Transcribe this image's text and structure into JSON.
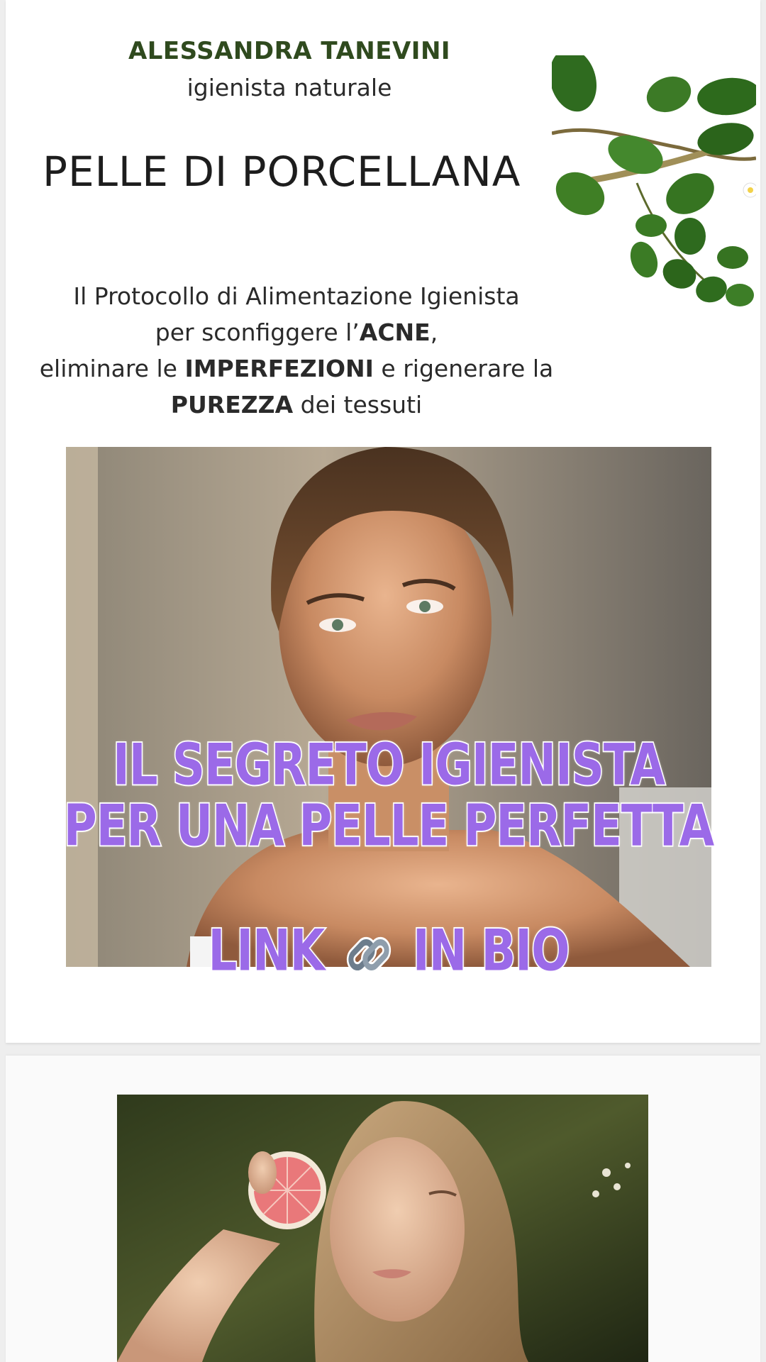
{
  "header": {
    "author_name": "ALESSANDRA TANEVINI",
    "author_role": "igienista naturale",
    "product_title": "PELLE DI PORCELLANA"
  },
  "description": {
    "line1": "Il Protocollo di Alimentazione Igienista",
    "line2_pre": "per sconfiggere l’",
    "line2_bold": "ACNE",
    "line2_post": ",",
    "line3_pre": "eliminare le ",
    "line3_bold": "IMPERFEZIONI",
    "line3_post": " e rigenerare la",
    "line4_bold": "PUREZZA",
    "line4_post": " dei tessuti"
  },
  "overlay": {
    "line1": "IL SEGRETO IGIENISTA",
    "line2": "PER UNA PELLE PERFETTA",
    "link_pre": "LINK",
    "link_post": "IN BIO",
    "link_icon": "link-icon",
    "color": "#9b6ae8"
  },
  "colors": {
    "author_green": "#2f4a1e",
    "overlay_purple": "#9b6ae8",
    "card_bg": "#ffffff",
    "page_bg": "#eeeeee"
  }
}
